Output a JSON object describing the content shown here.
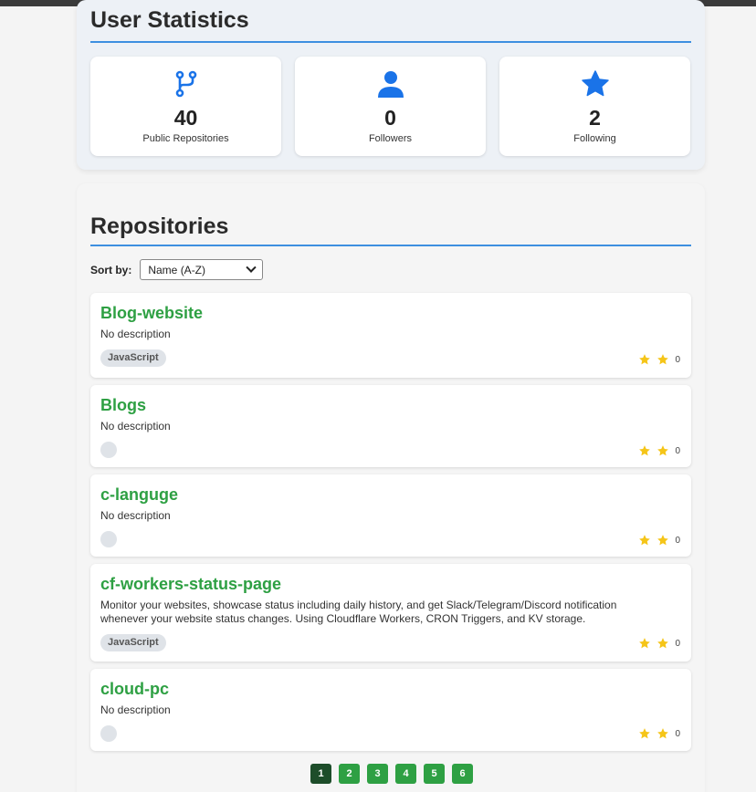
{
  "stats": {
    "title": "User Statistics",
    "cards": [
      {
        "icon": "fork-icon",
        "value": "40",
        "label": "Public Repositories"
      },
      {
        "icon": "user-icon",
        "value": "0",
        "label": "Followers"
      },
      {
        "icon": "star-icon",
        "value": "2",
        "label": "Following"
      }
    ]
  },
  "repos": {
    "title": "Repositories",
    "sort_label": "Sort by:",
    "sort_value": "Name (A-Z)",
    "items": [
      {
        "name": "Blog-website",
        "description": "No description",
        "language": "JavaScript",
        "stars": "0"
      },
      {
        "name": "Blogs",
        "description": "No description",
        "language": "",
        "stars": "0"
      },
      {
        "name": "c-languge",
        "description": "No description",
        "language": "",
        "stars": "0"
      },
      {
        "name": "cf-workers-status-page",
        "description": "Monitor your websites, showcase status including daily history, and get Slack/Telegram/Discord notification whenever your website status changes. Using Cloudflare Workers, CRON Triggers, and KV storage.",
        "language": "JavaScript",
        "stars": "0"
      },
      {
        "name": "cloud-pc",
        "description": "No description",
        "language": "",
        "stars": "0"
      }
    ]
  },
  "pagination": {
    "pages": [
      "1",
      "2",
      "3",
      "4",
      "5",
      "6"
    ],
    "current": "1"
  },
  "colors": {
    "accent_blue": "#1a73e8",
    "repo_green": "#2ea043",
    "star_yellow": "#f5c518",
    "page_active": "#1d4d2a"
  }
}
